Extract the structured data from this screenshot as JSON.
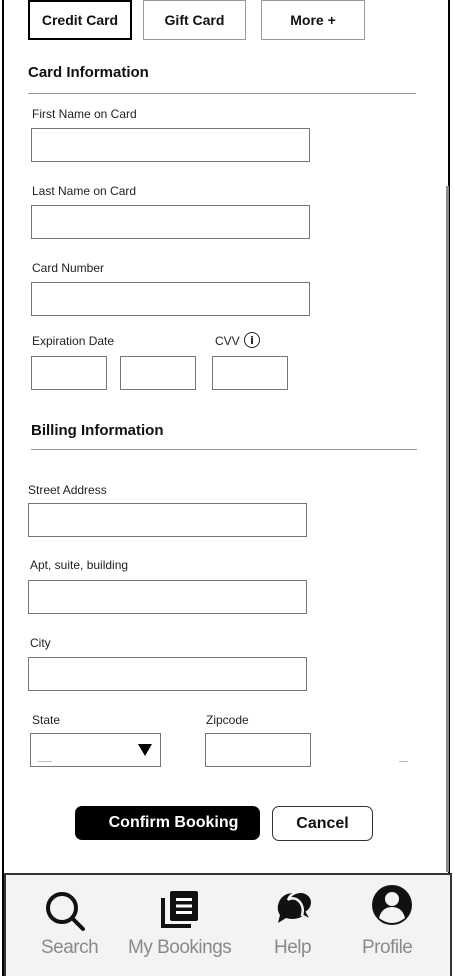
{
  "payment_tabs": [
    {
      "label": "Credit Card",
      "active": true
    },
    {
      "label": "Gift Card",
      "active": false
    },
    {
      "label": "More +",
      "active": false
    }
  ],
  "card_section": {
    "title": "Card Information",
    "first_name_label": "First Name on Card",
    "last_name_label": "Last Name on Card",
    "card_number_label": "Card Number",
    "expiration_label": "Expiration Date",
    "cvv_label": "CVV",
    "info_glyph": "i"
  },
  "billing_section": {
    "title": "Billing Information",
    "street_label": "Street Address",
    "apt_label": "Apt, suite, building",
    "city_label": "City",
    "state_label": "State",
    "zip_label": "Zipcode"
  },
  "actions": {
    "confirm_label": "Confirm Booking",
    "cancel_label": "Cancel"
  },
  "nav": [
    {
      "label": "Search",
      "icon": "search-icon"
    },
    {
      "label": "My Bookings",
      "icon": "bookings-icon"
    },
    {
      "label": "Help",
      "icon": "help-chat-icon"
    },
    {
      "label": "Profile",
      "icon": "profile-icon"
    }
  ]
}
